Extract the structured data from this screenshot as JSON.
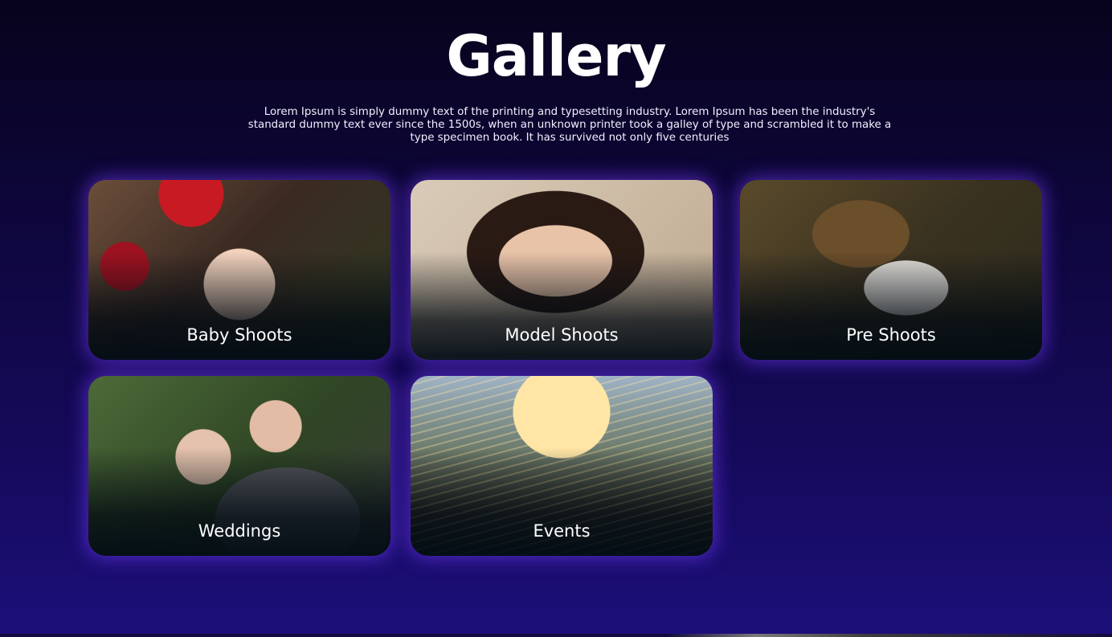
{
  "header": {
    "title": "Gallery",
    "description": "Lorem Ipsum is simply dummy text of the printing and typesetting industry. Lorem Ipsum has been the industry's standard dummy text ever since the 1500s, when an unknown printer took a galley of type and scrambled it to make a type specimen book. It has survived not only five centuries"
  },
  "gallery": {
    "cards": [
      {
        "label": "Baby Shoots",
        "icon": "baby-photo"
      },
      {
        "label": "Model Shoots",
        "icon": "model-photo"
      },
      {
        "label": "Pre Shoots",
        "icon": "couple-photo"
      },
      {
        "label": "Weddings",
        "icon": "wedding-photo"
      },
      {
        "label": "Events",
        "icon": "event-photo"
      }
    ]
  },
  "colors": {
    "background_top": "#07031c",
    "background_bottom": "#1c0f7a",
    "card_glow": "#783cff",
    "text": "#ffffff"
  }
}
